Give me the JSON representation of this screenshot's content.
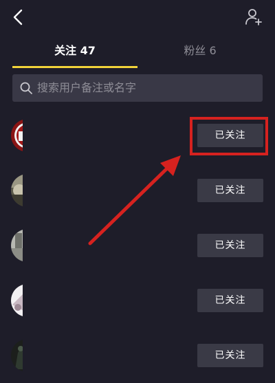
{
  "header": {
    "back_icon": "chevron-left-icon",
    "add_icon": "add-user-icon"
  },
  "tabs": [
    {
      "label": "关注 47",
      "active": true
    },
    {
      "label": "粉丝 6",
      "active": false
    }
  ],
  "search": {
    "placeholder": "搜索用户备注或名字",
    "value": ""
  },
  "follow_list": [
    {
      "button_label": "已关注"
    },
    {
      "button_label": "已关注"
    },
    {
      "button_label": "已关注"
    },
    {
      "button_label": "已关注"
    },
    {
      "button_label": "已关注"
    }
  ],
  "colors": {
    "background": "#1e1d29",
    "tab_indicator": "#f2d43a",
    "button_bg": "#3a3a46",
    "annotation_red": "#d6221f"
  }
}
